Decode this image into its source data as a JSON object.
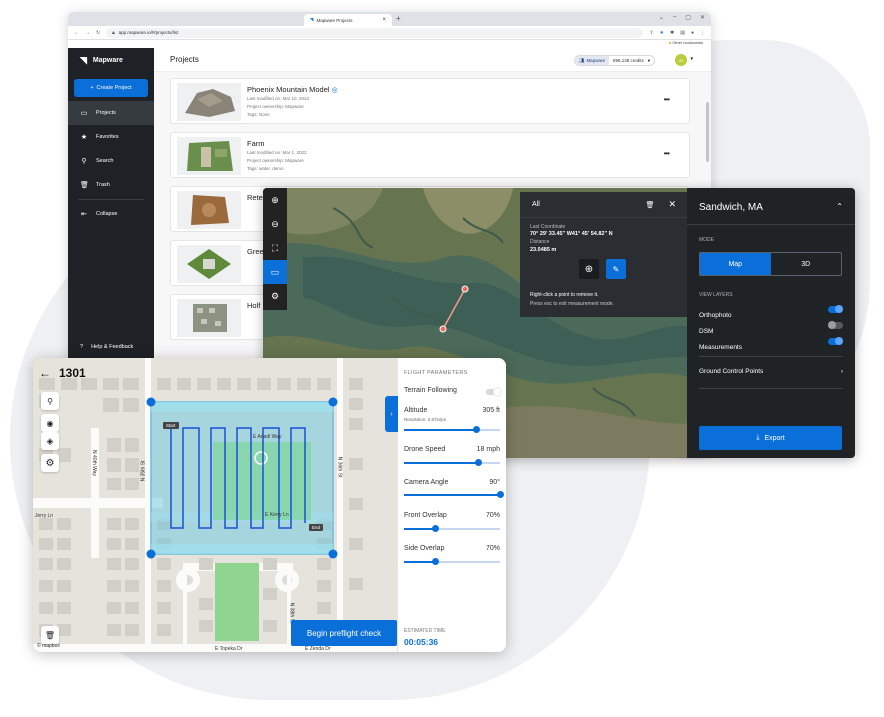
{
  "browser": {
    "tab_title": "Mapware Projects",
    "url": "app.mapware.io/#/projects/list",
    "bookmark_label": "Other bookmarks"
  },
  "sidebar": {
    "brand": "Mapware",
    "create_label": "Create Project",
    "items": [
      {
        "label": "Projects",
        "icon": "folder-icon"
      },
      {
        "label": "Favorites",
        "icon": "star-icon"
      },
      {
        "label": "Search",
        "icon": "search-icon"
      },
      {
        "label": "Trash",
        "icon": "trash-icon"
      },
      {
        "label": "Collapse",
        "icon": "collapse-icon"
      }
    ],
    "help_label": "Help & Feedback"
  },
  "header": {
    "title": "Projects",
    "org": "Mapware",
    "credits": "896,138 credits",
    "avatar": "JD"
  },
  "projects": [
    {
      "name": "Phoenix Mountain Model",
      "modified": "Last modified on: Mar 10, 2022",
      "ownership": "Project ownership: Mapware",
      "tags": "Tags: None"
    },
    {
      "name": "Farm",
      "modified": "Last modified on: Mar 1, 2022",
      "ownership": "Project ownership: Mapware",
      "tags": "Tags: water, demo"
    },
    {
      "name": "Reter"
    },
    {
      "name": "Green"
    },
    {
      "name": "Holf"
    }
  ],
  "map": {
    "measurement": {
      "tab": "All",
      "coord_label": "Last Coordinate",
      "coord_value": "70° 29' 33.45\" W41° 45' 54.82\" N",
      "distance_label": "Distance",
      "distance_value": "23.0485 m",
      "help_line1": "Right-click a point to remove it.",
      "help_line2": "Press esc to exit measurement mode."
    },
    "panel": {
      "title": "Sandwich, MA",
      "mode_label": "MODE",
      "mode_map": "Map",
      "mode_3d": "3D",
      "layers_label": "VIEW LAYERS",
      "layers": [
        {
          "name": "Orthophoto",
          "on": true
        },
        {
          "name": "DSM",
          "on": false
        },
        {
          "name": "Measurements",
          "on": true
        }
      ],
      "gcp_label": "Ground Control Points",
      "export_label": "Export"
    }
  },
  "planner": {
    "mission_id": "1301",
    "start_label": "Start",
    "end_label": "End",
    "streets": [
      "E Ariadi Way",
      "E Kerry Ln",
      "E Topeka Dr",
      "E Zenda Dr",
      "N 36th St",
      "N 35th St",
      "N 38th St",
      "N 40th Way",
      "Jerry Ln"
    ],
    "params_title": "FLIGHT PARAMETERS",
    "terrain_label": "Terrain Following",
    "terrain_on": false,
    "altitude_label": "Altitude",
    "altitude_value": "305 ft",
    "resolution": "Resolution: 0.67in/px",
    "altitude_level": 0.75,
    "speed_label": "Drone Speed",
    "speed_value": "18 mph",
    "speed_level": 0.78,
    "angle_label": "Camera Angle",
    "angle_value": "90°",
    "angle_level": 1.0,
    "front_label": "Front Overlap",
    "front_value": "70%",
    "front_level": 0.33,
    "side_label": "Side Overlap",
    "side_value": "70%",
    "side_level": 0.33,
    "est_label": "ESTIMATED TIME",
    "est_value": "00:05:36",
    "begin_label": "Begin preflight check",
    "attribution": "© mapbox"
  },
  "colors": {
    "accent": "#0a6fd8",
    "sidebar_bg": "#1e2226",
    "panel_bg": "#1f2326",
    "flight_area": "#5cc4d8"
  }
}
